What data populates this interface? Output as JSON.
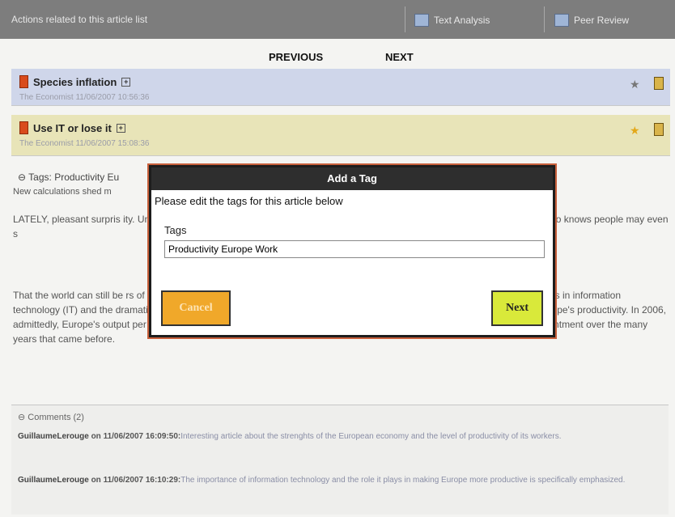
{
  "topbar": {
    "title": "Actions related to this article list",
    "tab1": "Text Analysis",
    "tab2": "Peer Review"
  },
  "nav": {
    "previous": "PREVIOUS",
    "next": "NEXT"
  },
  "articles": [
    {
      "title": "Species inflation",
      "expand": "+",
      "meta": "The Economist   11/06/2007 10:56:36",
      "star": "★"
    },
    {
      "title": "Use IT or lose it",
      "expand": "+",
      "meta": "The Economist   11/06/2007 15:08:36",
      "star": "★"
    }
  ],
  "article_body": {
    "tags": "⊖ Tags: Productivity Eu",
    "subtitle": "New calculations shed m",
    "para1": "LATELY, pleasant surpris                                                                                  ity. Unemployment in the euro zone ticks down                                                                            ds that German businessmen are even m                                                                                  this and who knows people may even s",
    "para2": "That the world can still be                                                                                             rs of its economic performance, especially                                                                                20 sluggish years. American productivity gro                                                                               the advances in information technology (IT) and the dramatic cheapening of computing power that lay behind that surge have had much less effect on Europe's productivity. In 2006, admittedly, Europe's output per hour grew faster than America's. But the cheer over that number merely points up the disappointment over the many years that came before."
  },
  "comments": {
    "header": "⊖ Comments (2)",
    "items": [
      {
        "author": "GuillaumeLerouge",
        "date": " on 11/06/2007 16:09:50:",
        "text": "Interesting article about the strenghts of the European economy and the level of productivity of its workers."
      },
      {
        "author": "GuillaumeLerouge",
        "date": " on 11/06/2007 16:10:29:",
        "text": "The importance of information technology and the role it plays in making Europe more productive is specifically emphasized."
      }
    ]
  },
  "dialog": {
    "title": "Add a Tag",
    "instructions": "Please edit the tags for this article below",
    "tags_label": "Tags",
    "tags_value": "Productivity Europe Work",
    "cancel": "Cancel",
    "next": "Next"
  }
}
